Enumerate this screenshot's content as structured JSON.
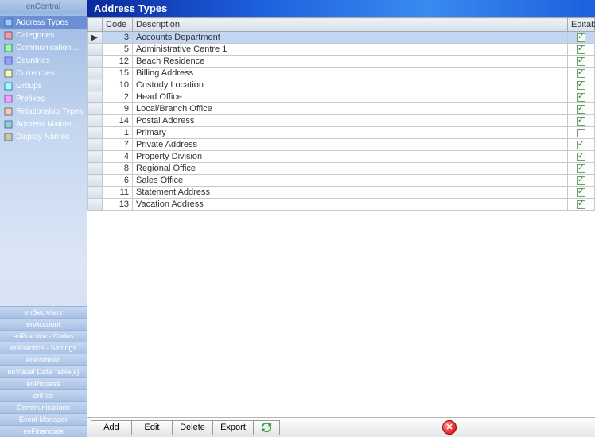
{
  "sidebar": {
    "header": "enCentral",
    "nav": [
      {
        "label": "Address Types",
        "active": true
      },
      {
        "label": "Categories"
      },
      {
        "label": "Communication Types"
      },
      {
        "label": "Countries"
      },
      {
        "label": "Currencies"
      },
      {
        "label": "Groups"
      },
      {
        "label": "Prefixes"
      },
      {
        "label": "Relationship Types"
      },
      {
        "label": "Address Maintenance"
      },
      {
        "label": "Display Names"
      }
    ],
    "sections": [
      "enSecretary",
      "enAccount",
      "enPractice - Codes",
      "enPractice - Settings",
      "enPortfolio",
      "enVisual Data Table(s)",
      "enProcess",
      "enFee",
      "Communications",
      "Event Manager",
      "enFinancials"
    ]
  },
  "main": {
    "title": "Address Types",
    "columns": {
      "handle": "",
      "code": "Code",
      "description": "Description",
      "editable": "Editable"
    },
    "rows": [
      {
        "code": 3,
        "desc": "Accounts Department",
        "editable": true,
        "selected": true
      },
      {
        "code": 5,
        "desc": "Administrative Centre 1",
        "editable": true
      },
      {
        "code": 12,
        "desc": "Beach Residence",
        "editable": true
      },
      {
        "code": 15,
        "desc": "Billing Address",
        "editable": true
      },
      {
        "code": 10,
        "desc": "Custody Location",
        "editable": true
      },
      {
        "code": 2,
        "desc": "Head Office",
        "editable": true
      },
      {
        "code": 9,
        "desc": "Local/Branch Office",
        "editable": true
      },
      {
        "code": 14,
        "desc": "Postal Address",
        "editable": true
      },
      {
        "code": 1,
        "desc": "Primary",
        "editable": false
      },
      {
        "code": 7,
        "desc": "Private Address",
        "editable": true
      },
      {
        "code": 4,
        "desc": "Property Division",
        "editable": true
      },
      {
        "code": 8,
        "desc": "Regional Office",
        "editable": true
      },
      {
        "code": 6,
        "desc": "Sales Office",
        "editable": true
      },
      {
        "code": 11,
        "desc": "Statement Address",
        "editable": true
      },
      {
        "code": 13,
        "desc": "Vacation Address",
        "editable": true
      }
    ]
  },
  "toolbar": {
    "add": "Add",
    "edit": "Edit",
    "delete": "Delete",
    "export": "Export"
  },
  "icons": {
    "nav_fills": [
      "#9cf",
      "#f99",
      "#9f9",
      "#99f",
      "#ff9",
      "#9ff",
      "#f9f",
      "#fc9",
      "#9cc",
      "#cc9"
    ]
  }
}
